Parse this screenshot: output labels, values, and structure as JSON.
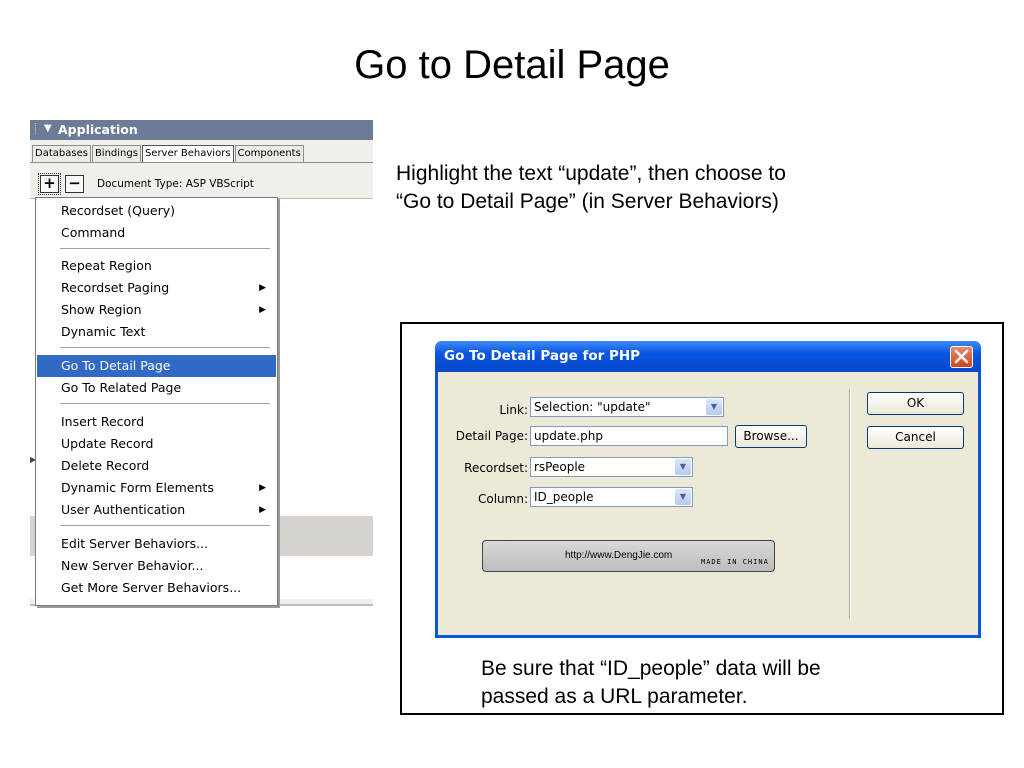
{
  "slide": {
    "title": "Go to Detail Page",
    "instruction_lines": [
      "Highlight the text “update”, then choose to",
      "“Go to Detail Page” (in Server Behaviors)"
    ],
    "note_lines": [
      "Be sure that “ID_people” data will be",
      "passed as a URL parameter."
    ]
  },
  "panel": {
    "title": "Application",
    "tabs": [
      "Databases",
      "Bindings",
      "Server Behaviors",
      "Components"
    ],
    "active_tab": "Server Behaviors",
    "add_symbol": "+",
    "remove_symbol": "−",
    "document_type": "Document Type: ASP VBScript"
  },
  "menu": {
    "items": [
      "Recordset (Query)",
      "Command",
      "Repeat Region",
      "Recordset Paging",
      "Show Region",
      "Dynamic Text",
      "Go To Detail Page",
      "Go To Related Page",
      "Insert Record",
      "Update Record",
      "Delete Record",
      "Dynamic Form Elements",
      "User Authentication",
      "Edit Server Behaviors...",
      "New Server Behavior...",
      "Get More Server Behaviors..."
    ],
    "highlighted": "Go To Detail Page",
    "submenu_arrow": "▶"
  },
  "dialog": {
    "title": "Go To Detail Page for PHP",
    "link_label": "Link:",
    "link_value": "Selection: \"update\"",
    "detail_page_label": "Detail Page:",
    "detail_page_value": "update.php",
    "browse_button": "Browse...",
    "recordset_label": "Recordset:",
    "recordset_value": "rsPeople",
    "column_label": "Column:",
    "column_value": "ID_people",
    "ok_button": "OK",
    "cancel_button": "Cancel",
    "watermark_url": "http://www.DengJie.com",
    "watermark_tag": "MADE IN CHINA",
    "dropdown_glyph": "▼",
    "close_glyph": "✕"
  }
}
